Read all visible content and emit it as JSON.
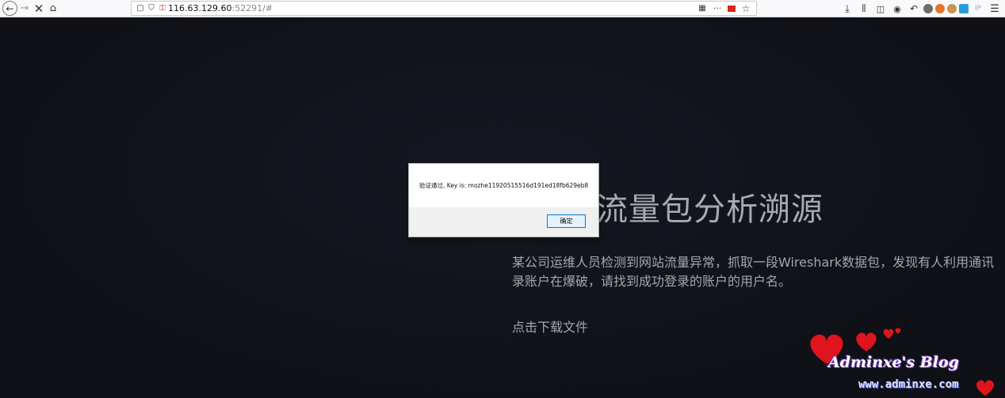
{
  "browser": {
    "url_host": "116.63.129.60",
    "url_rest": ":52291/#",
    "ext_label": "IP"
  },
  "page": {
    "headline": "流量包分析溯源",
    "description": "某公司运维人员检测到网站流量异常，抓取一段Wireshark数据包，发现有人利用通讯录账户在爆破，请找到成功登录的账户的用户名。",
    "download_link": "点击下载文件"
  },
  "dialog": {
    "message": "验证通过, Key is: mozhe11920515516d191ed18fb629eb8",
    "ok_label": "确定"
  },
  "watermark": {
    "name": "Adminxe's Blog",
    "url": "www.adminxe.com"
  },
  "colors": {
    "page_bg": "#0f1117",
    "text": "#a3a6ac",
    "button_border": "#0078d7"
  }
}
